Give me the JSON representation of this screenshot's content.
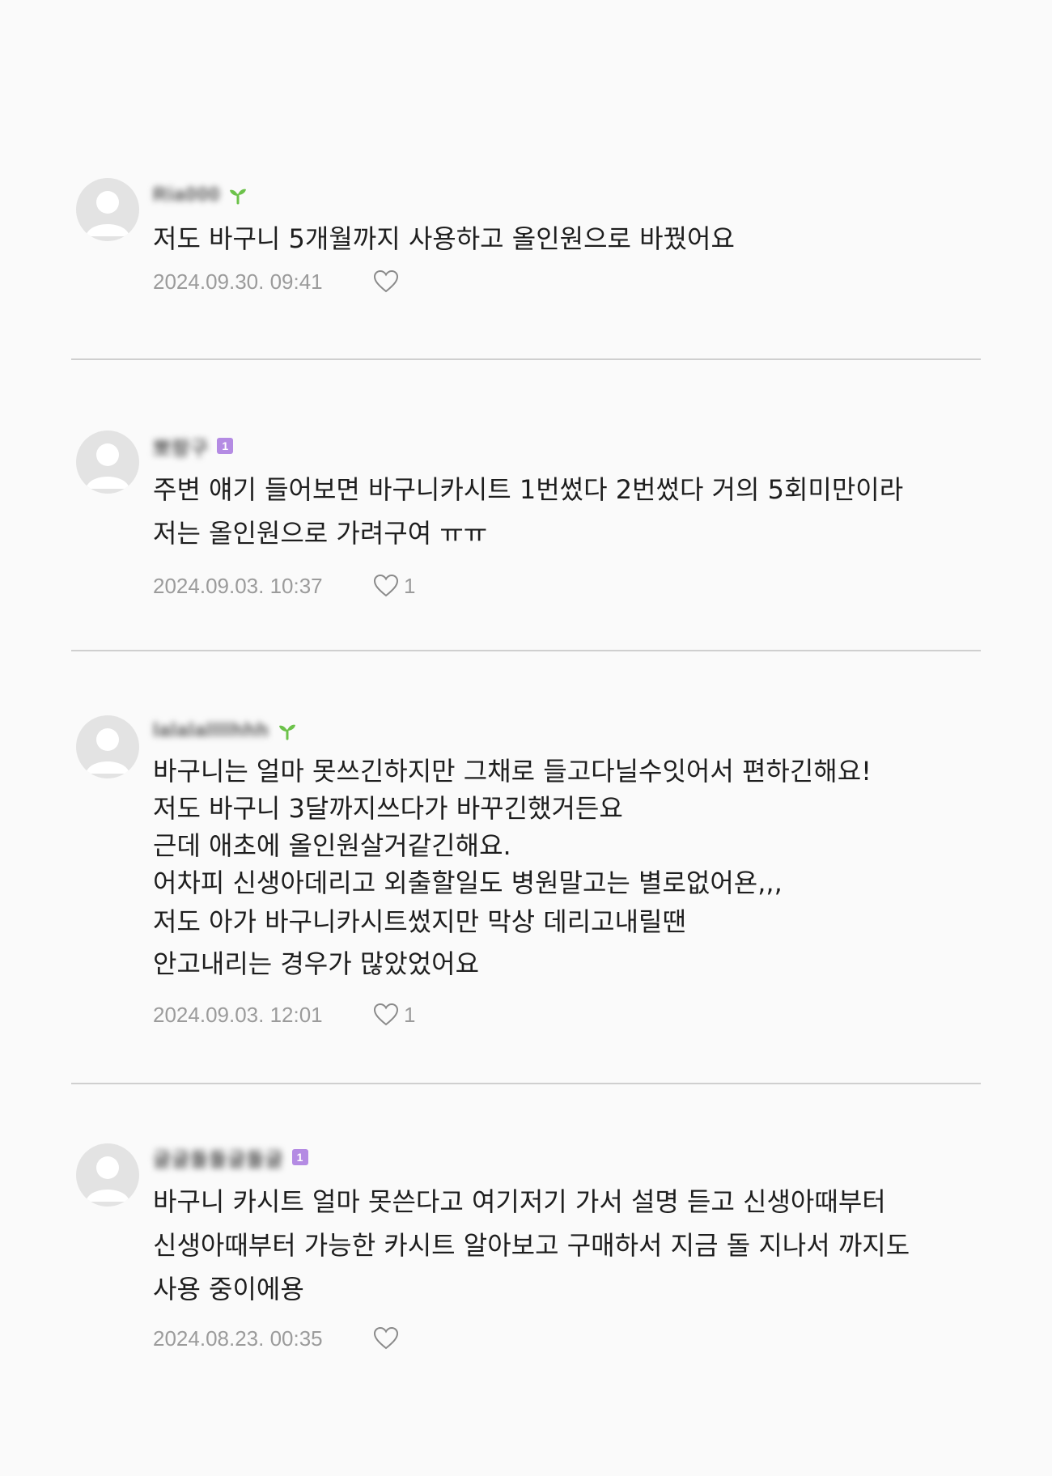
{
  "colors": {
    "background": "#fafafa",
    "text": "#1e1e1e",
    "meta_text": "#9b9b9b",
    "divider": "#cfcfcf",
    "sprout_badge": "#6cc24a",
    "level_badge": "#b48be3"
  },
  "comments": [
    {
      "nickname": "Ria000",
      "badge": "sprout-icon",
      "lines": [
        "저도 바구니 5개월까지 사용하고 올인원으로 바꿨어요"
      ],
      "date": "2024.09.30. 09:41",
      "likes": ""
    },
    {
      "nickname": "뽀랑구",
      "badge": "level-1",
      "badge_text": "1",
      "lines": [
        "주변 얘기 들어보면 바구니카시트 1번썼다 2번썼다 거의 5회미만이라",
        "저는 올인원으로 가려구여 ㅠㅠ"
      ],
      "date": "2024.09.03. 10:37",
      "likes": "1"
    },
    {
      "nickname": "lalalallllhhh",
      "badge": "sprout-icon",
      "lines": [
        "바구니는 얼마 못쓰긴하지만 그채로 들고다닐수잇어서 편하긴해요!",
        "저도 바구니 3달까지쓰다가 바꾸긴했거든요",
        "근데 애초에 올인원살거같긴해요.",
        "어차피 신생아데리고 외출할일도 병원말고는 별로없어욘,,,",
        "저도 아가 바구니카시트썼지만 막상 데리고내릴땐",
        "안고내리는 경우가 많았었어요"
      ],
      "date": "2024.09.03. 12:01",
      "likes": "1"
    },
    {
      "nickname": "글글돌돌글돌글",
      "badge": "level-1",
      "badge_text": "1",
      "lines": [
        "바구니 카시트 얼마 못쓴다고 여기저기 가서 설명 듣고 신생아때부터",
        "신생아때부터 가능한 카시트 알아보고 구매하서 지금 돌 지나서 까지도",
        "사용 중이에용"
      ],
      "date": "2024.08.23. 00:35",
      "likes": ""
    }
  ]
}
